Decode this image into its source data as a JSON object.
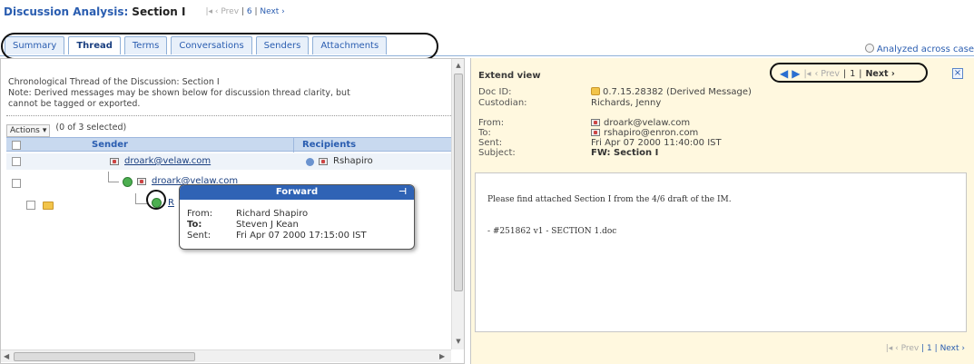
{
  "header": {
    "title": "Discussion Analysis:",
    "section": "Section I",
    "pager": {
      "first": "|◂",
      "prev": "‹ Prev",
      "sep1": "|",
      "page": "6",
      "sep2": "|",
      "next": "Next ›"
    }
  },
  "tabs": [
    {
      "label": "Summary",
      "active": false
    },
    {
      "label": "Thread",
      "active": true
    },
    {
      "label": "Terms",
      "active": false
    },
    {
      "label": "Conversations",
      "active": false
    },
    {
      "label": "Senders",
      "active": false
    },
    {
      "label": "Attachments",
      "active": false
    }
  ],
  "analyzed_link": "Analyzed across case",
  "left": {
    "note_line1": "Chronological Thread of the Discussion: Section I",
    "note_line2": "Note: Derived messages may be shown below for discussion thread clarity, but",
    "note_line3": "cannot be tagged or exported.",
    "actions_label": "Actions",
    "selected_count": "(0 of 3 selected)",
    "columns": {
      "sender": "Sender",
      "recipients": "Recipients"
    },
    "rows": [
      {
        "sender": "droark@velaw.com",
        "recipient": "Rshapiro"
      },
      {
        "sender": "droark@velaw.com",
        "recipient": ""
      },
      {
        "sender": "R",
        "recipient": ""
      }
    ]
  },
  "popup": {
    "title": "Forward",
    "from_label": "From:",
    "from_value": "Richard Shapiro",
    "to_label": "To:",
    "to_value": "Steven J Kean",
    "sent_label": "Sent:",
    "sent_value": "Fri Apr 07 2000 17:15:00 IST"
  },
  "right": {
    "title": "Extend view",
    "nav": {
      "first": "◀",
      "next_icon": "▶",
      "first_ds": "|◂",
      "prev": "‹ Prev",
      "sep1": "|",
      "page": "1",
      "sep2": "|",
      "next": "Next ›"
    },
    "close": "×",
    "docid_label": "Doc ID:",
    "docid_value": "0.7.15.28382 (Derived Message)",
    "custodian_label": "Custodian:",
    "custodian_value": "Richards, Jenny",
    "from_label": "From:",
    "from_value": "droark@velaw.com",
    "to_label": "To:",
    "to_value": "rshapiro@enron.com",
    "sent_label": "Sent:",
    "sent_value": "Fri Apr 07 2000 11:40:00 IST",
    "subject_label": "Subject:",
    "subject_value": "FW: Section I",
    "body_line1": "Please find attached Section I from the 4/6 draft of the IM.",
    "body_line2": "- #251862 v1 - SECTION 1.doc",
    "bottom_pager": {
      "first": "|◂",
      "prev": "‹ Prev",
      "sep1": "|",
      "page": "1",
      "sep2": "|",
      "next": "Next ›"
    }
  }
}
